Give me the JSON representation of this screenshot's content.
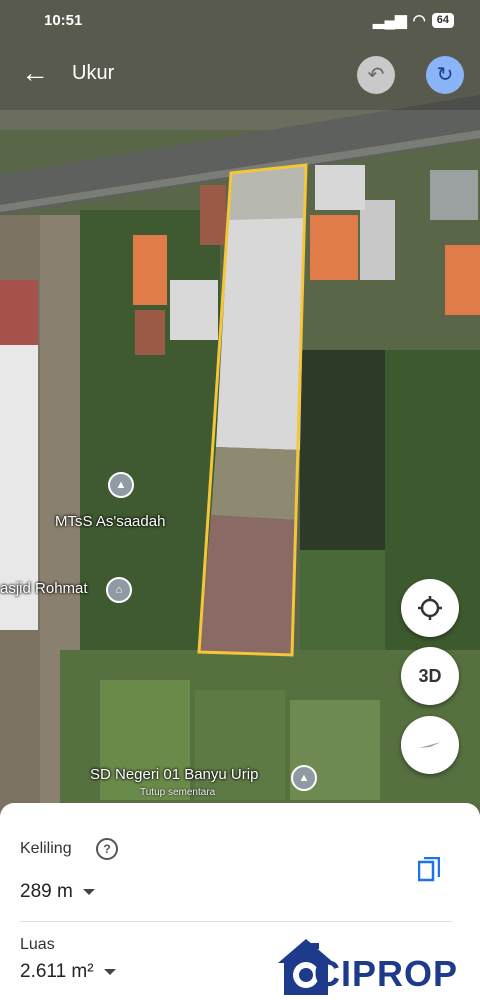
{
  "status": {
    "time": "10:51",
    "battery": "64"
  },
  "toolbar": {
    "title": "Ukur"
  },
  "map_labels": {
    "school1": "MTsS As'saadah",
    "mosque": "asjid Rohmat",
    "school2": "SD Negeri 01 Banyu Urip",
    "school2_status": "Tutup sementara"
  },
  "controls": {
    "three_d": "3D"
  },
  "panel": {
    "perimeter_label": "Keliling",
    "perimeter_value": "289 m",
    "area_label": "Luas",
    "area_value": "2.611 m²"
  },
  "watermark": {
    "text": "CIPROP"
  },
  "colors": {
    "outline": "#f5c53a",
    "accent": "#1a73e8",
    "logo": "#1e3a8a"
  }
}
